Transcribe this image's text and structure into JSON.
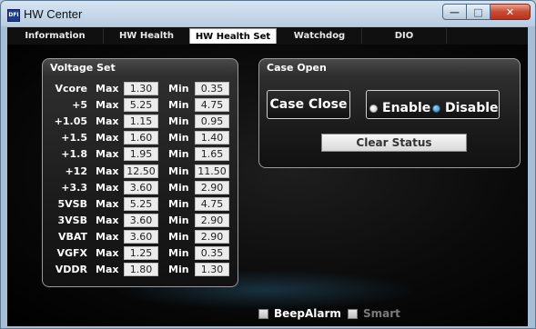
{
  "window": {
    "title": "HW Center",
    "icon_text": "DFI"
  },
  "tabs": [
    {
      "label": "Information"
    },
    {
      "label": "HW Health"
    },
    {
      "label": "HW Health Set"
    },
    {
      "label": "Watchdog"
    },
    {
      "label": "DIO"
    }
  ],
  "voltage_set": {
    "title": "Voltage Set",
    "max_label": "Max",
    "min_label": "Min",
    "rows": [
      {
        "name": "Vcore",
        "max": "1.30",
        "min": "0.35"
      },
      {
        "name": "+5",
        "max": "5.25",
        "min": "4.75"
      },
      {
        "name": "+1.05",
        "max": "1.15",
        "min": "0.95"
      },
      {
        "name": "+1.5",
        "max": "1.60",
        "min": "1.40"
      },
      {
        "name": "+1.8",
        "max": "1.95",
        "min": "1.65"
      },
      {
        "name": "+12",
        "max": "12.50",
        "min": "11.50"
      },
      {
        "name": "+3.3",
        "max": "3.60",
        "min": "2.90"
      },
      {
        "name": "5VSB",
        "max": "5.25",
        "min": "4.75"
      },
      {
        "name": "3VSB",
        "max": "3.60",
        "min": "2.90"
      },
      {
        "name": "VBAT",
        "max": "3.60",
        "min": "2.90"
      },
      {
        "name": "VGFX",
        "max": "1.25",
        "min": "0.35"
      },
      {
        "name": "VDDR",
        "max": "1.80",
        "min": "1.30"
      }
    ]
  },
  "case_open": {
    "title": "Case Open",
    "case_close_label": "Case Close",
    "enable_label": "Enable",
    "disable_label": "Disable",
    "clear_status_label": "Clear Status"
  },
  "options": {
    "beep_alarm_label": "BeepAlarm",
    "smart_label": "Smart"
  },
  "colors": {
    "accent_glow": "#3c96c8",
    "text": "#ffffff",
    "disabled_text": "#7a7a7a"
  }
}
